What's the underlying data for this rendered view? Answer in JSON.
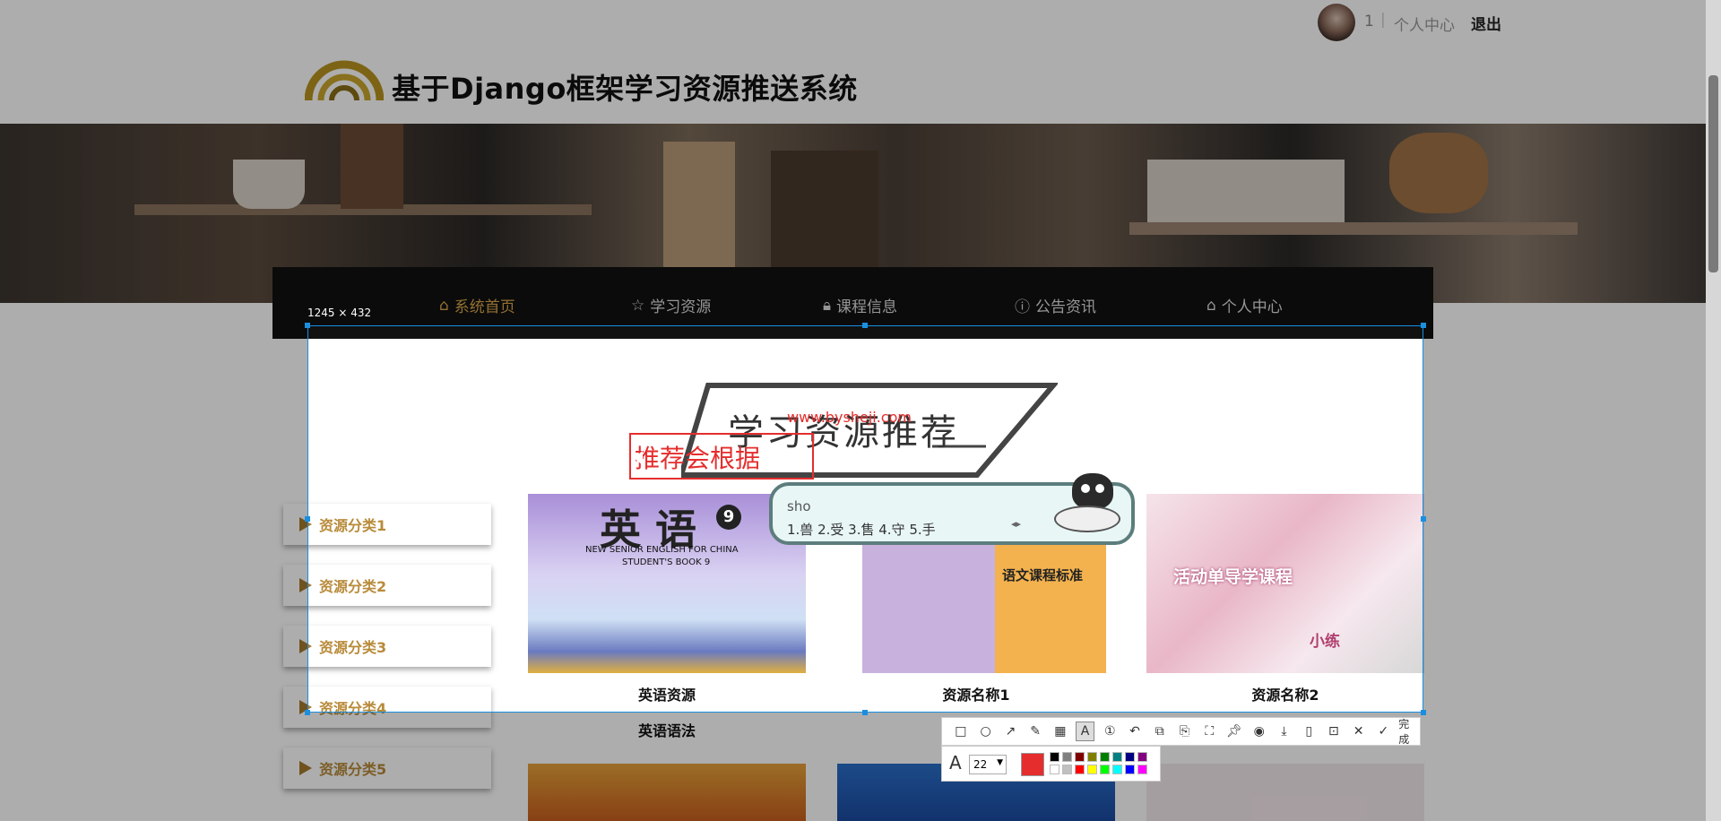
{
  "topbar": {
    "username": "1",
    "separator": "|",
    "user_center": "个人中心",
    "logout": "退出"
  },
  "header": {
    "site_title": "基于Django框架学习资源推送系统"
  },
  "nav": {
    "items": [
      {
        "icon": "home-icon",
        "label": "系统首页",
        "active": true
      },
      {
        "icon": "star-icon",
        "label": "学习资源",
        "active": false
      },
      {
        "icon": "lock-icon",
        "label": "课程信息",
        "active": false
      },
      {
        "icon": "info-icon",
        "label": "公告资讯",
        "active": false
      },
      {
        "icon": "home-icon",
        "label": "个人中心",
        "active": false
      }
    ]
  },
  "main": {
    "section_title": "学习资源推荐",
    "categories": [
      "资源分类1",
      "资源分类2",
      "资源分类3",
      "资源分类4",
      "资源分类5"
    ],
    "cards": [
      {
        "label": "英语资源",
        "subtitle": "英语语法",
        "cover_title": "英 语",
        "cover_text1": "NEW SENIOR ENGLISH FOR CHINA",
        "cover_text2": "STUDENT'S BOOK 9",
        "cover_badge": "9"
      },
      {
        "label": "资源名称1",
        "cover_title": "语文课程标准"
      },
      {
        "label": "资源名称2",
        "cover_title": "活动单导学课程",
        "cover_title2": "小练"
      }
    ]
  },
  "screenshot_tool": {
    "size_label": "1245 × 432",
    "text_annotation": "推荐会根据",
    "watermark": "www.bysheji.com",
    "font_size_value": "22",
    "done_label": "完成",
    "ime": {
      "typed": "sho",
      "candidates": "1.兽  2.受  3.售  4.守  5.手"
    },
    "colors": {
      "selection": "#1a8fe0",
      "annotation": "#e52d2d"
    },
    "palette": [
      "#000000",
      "#808080",
      "#800000",
      "#808000",
      "#008000",
      "#008080",
      "#000080",
      "#800080",
      "#ffffff",
      "#c0c0c0",
      "#ff0000",
      "#ffff00",
      "#00ff00",
      "#00ffff",
      "#0000ff",
      "#ff00ff"
    ]
  }
}
